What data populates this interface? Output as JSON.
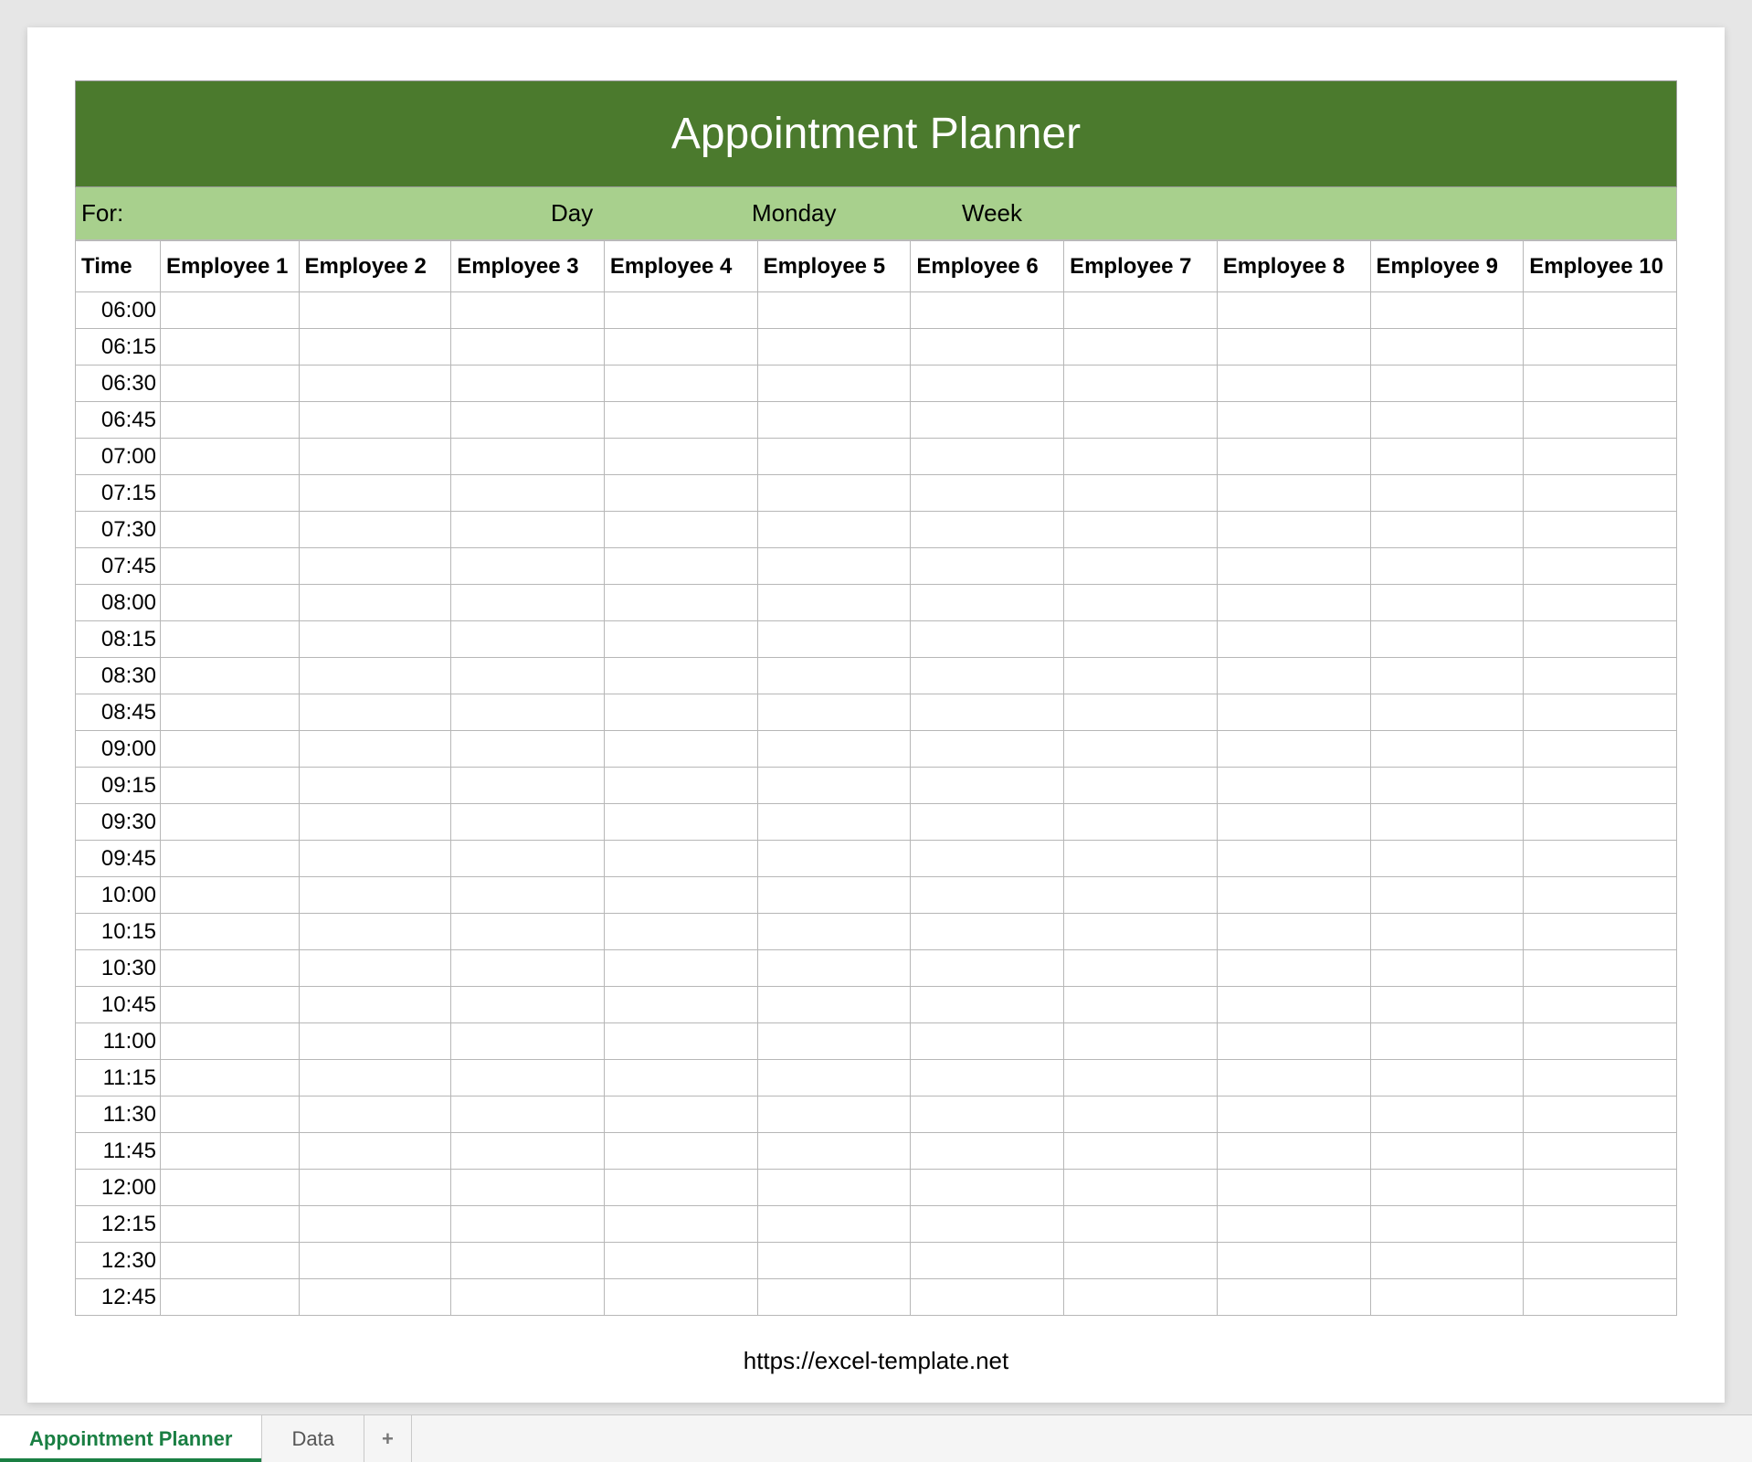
{
  "colors": {
    "header_bg": "#4b7a2d",
    "meta_bg": "#a8d08d",
    "active_tab": "#1a7f43"
  },
  "header": {
    "title": "Appointment Planner"
  },
  "meta": {
    "for_label": "For:",
    "for_value": "",
    "day_label": "Day",
    "day_value": "Monday",
    "week_label": "Week",
    "week_value": ""
  },
  "columns": {
    "time": "Time",
    "employees": [
      "Employee 1",
      "Employee 2",
      "Employee 3",
      "Employee 4",
      "Employee 5",
      "Employee 6",
      "Employee 7",
      "Employee 8",
      "Employee 9",
      "Employee 10"
    ]
  },
  "time_slots": [
    "06:00",
    "06:15",
    "06:30",
    "06:45",
    "07:00",
    "07:15",
    "07:30",
    "07:45",
    "08:00",
    "08:15",
    "08:30",
    "08:45",
    "09:00",
    "09:15",
    "09:30",
    "09:45",
    "10:00",
    "10:15",
    "10:30",
    "10:45",
    "11:00",
    "11:15",
    "11:30",
    "11:45",
    "12:00",
    "12:15",
    "12:30",
    "12:45"
  ],
  "footer": {
    "link_text": "https://excel-template.net"
  },
  "tabs": {
    "items": [
      {
        "label": "Appointment Planner",
        "active": true
      },
      {
        "label": "Data",
        "active": false
      }
    ],
    "add_label": "+"
  }
}
